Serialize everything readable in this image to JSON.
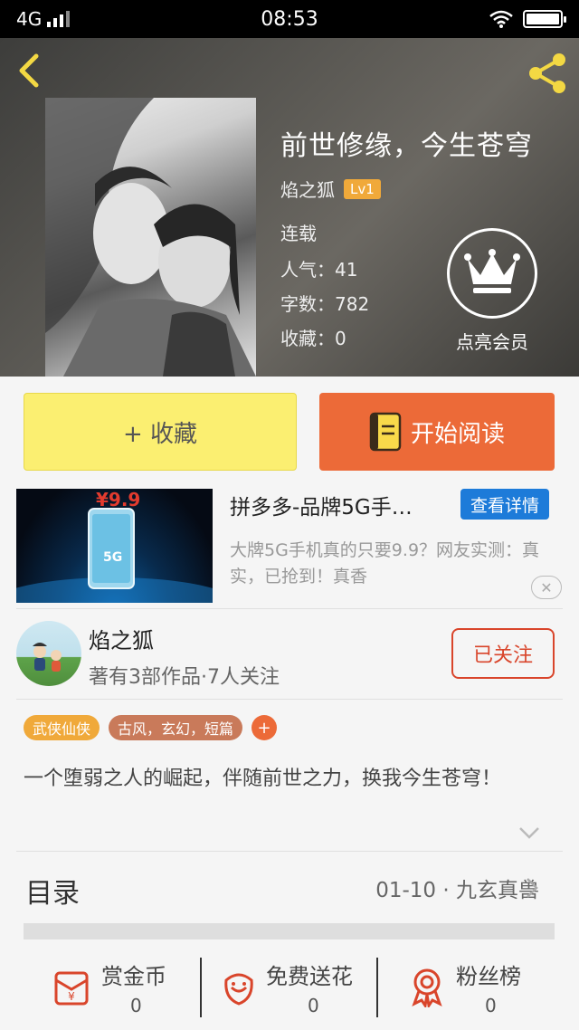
{
  "status_bar": {
    "network": "4G",
    "time": "08:53",
    "battery_level": 1.0
  },
  "book": {
    "title": "前世修缘，今生苍穹",
    "author": "焰之狐",
    "level": "Lv1",
    "status": "连载",
    "popularity": "人气：41",
    "word_count": "字数：782",
    "favorites": "收藏：0",
    "vip_label": "点亮会员"
  },
  "actions": {
    "collect": "+ 收藏",
    "read": "开始阅读"
  },
  "ad": {
    "image_price": "¥9.9",
    "image_badge": "5G",
    "title": "拼多多-品牌5G手…",
    "button": "查看详情",
    "description": "大牌5G手机真的只要9.9？网友实测：真实，已抢到！真香",
    "close_icon": "close-icon"
  },
  "author_block": {
    "name": "焰之狐",
    "subtitle": "著有3部作品·7人关注",
    "follow_label": "已关注"
  },
  "tags": {
    "genre": "武侠仙侠",
    "keywords": "古风，玄幻，短篇",
    "add": "+"
  },
  "synopsis": "一个堕弱之人的崛起，伴随前世之力，换我今生苍穹！",
  "catalog": {
    "label": "目录",
    "latest": "01-10 · 九玄真兽"
  },
  "bottom_bar": [
    {
      "label": "赏金币",
      "count": "0",
      "icon": "red-envelope-icon"
    },
    {
      "label": "免费送花",
      "count": "0",
      "icon": "flower-icon"
    },
    {
      "label": "粉丝榜",
      "count": "0",
      "icon": "medal-icon"
    }
  ],
  "colors": {
    "accent_orange": "#ec6a38",
    "accent_yellow": "#fbef71",
    "link_blue": "#1d7bd9",
    "follow_red": "#d9452b",
    "level_gold": "#f0a93a"
  }
}
